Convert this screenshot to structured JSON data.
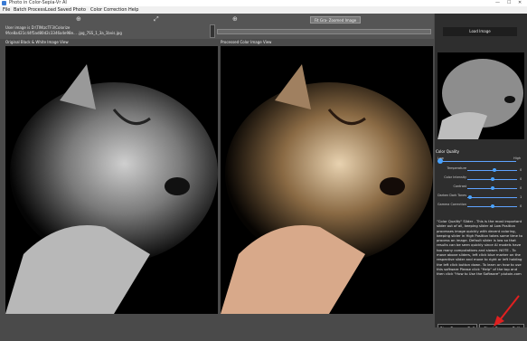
{
  "window": {
    "title": "Photo in Color-Sepia-Vr AI"
  },
  "menu": [
    "File",
    "Batch Process",
    "Load Saved Photo",
    "Color Correction",
    "Help"
  ],
  "toolbar": {
    "path_line1": "User image is D:\\TIN\\zcTF3\\Colorize",
    "path_line2": "9fce8a421c44f5ad80d2c3346a4e98e... .jpg_7SS_1_3a_1bvis.jpg",
    "fit_button": "Fit Gra- Zoomed Image"
  },
  "panels": {
    "left_title": "Original Black & White  Image View",
    "right_title": "Processed Color Image View"
  },
  "side": {
    "load_image": "Load Image",
    "color_quality_label": "Color Quality",
    "color_quality_high": "High",
    "color_quality_low": "Low",
    "sliders": [
      {
        "label": "Temperature",
        "value": "0",
        "pos": 0.55
      },
      {
        "label": "Color Intensity",
        "value": "0",
        "pos": 0.5
      },
      {
        "label": "Contrast",
        "value": "0",
        "pos": 0.5
      },
      {
        "label": "Darken Dark Tones",
        "value": "1",
        "pos": 0.05
      },
      {
        "label": "Gamma Correction",
        "value": "0",
        "pos": 0.5
      }
    ],
    "help_text": "\"Color Quality\" Slider - This is the most important slider out of all, keeping slider at Low Position processes image quickly with decent coloring, keeping slider in High Position takes some time to process an image. Default slider is low so that results can be seen quickly since AI models have too many computations and slower. NOTE - To move above sliders, left click blue marker on the respective slider and move to right or left holding the left click button down. To learn on how to use this software Please click \"Help\" of the top and then click \"How to Use the Software\" piutoin.com",
    "btn_stop": "Stop Process Full Image",
    "btn_start": "Start Process Full Image and Save"
  },
  "colors": {
    "accent": "#4aa3ff",
    "arrow": "#e02020"
  }
}
